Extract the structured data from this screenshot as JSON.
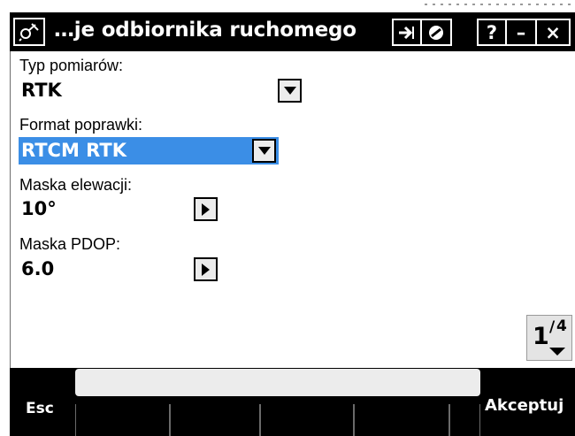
{
  "window": {
    "title": "…je odbiornika ruchomego",
    "buttons": {
      "help": "?",
      "minimize": "–",
      "close": "×"
    }
  },
  "form": {
    "survey_type": {
      "label": "Typ pomiarów:",
      "value": "RTK"
    },
    "correction_format": {
      "label": "Format poprawki:",
      "value": "RTCM RTK"
    },
    "elevation_mask": {
      "label": "Maska elewacji:",
      "value": "10°"
    },
    "pdop_mask": {
      "label": "Maska PDOP:",
      "value": "6.0"
    }
  },
  "page_indicator": {
    "current": "1",
    "total": "4"
  },
  "softkeys": {
    "esc": "Esc",
    "accept": "Akceptuj"
  },
  "colors": {
    "selection": "#3b8ee6",
    "titlebar": "#000000",
    "softbar": "#000000"
  },
  "icons": [
    "app-icon",
    "forward-icon",
    "no-entry-icon",
    "help-icon",
    "minimize-icon",
    "close-icon",
    "dropdown-arrow-icon",
    "right-arrow-icon",
    "page-down-icon"
  ]
}
